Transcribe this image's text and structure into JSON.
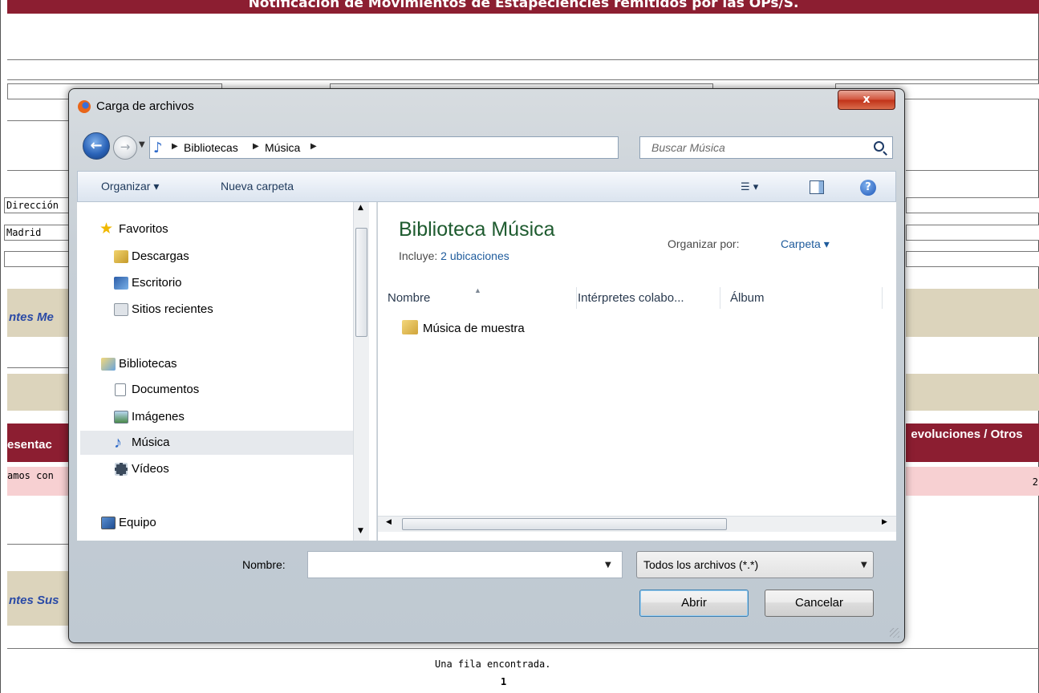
{
  "background": {
    "banner_title": "Notificación de Movimientos de Estapeciencies remitidos por las OPs/S.",
    "field_direccion": "Dirección",
    "field_madrid": "Madrid",
    "section_1": "ntes Me",
    "section_2": "ntes Sus",
    "table_header_left": "esentac",
    "table_header_right": "evoluciones / Otros",
    "row_text_left": "amos con",
    "row_value_right": "2",
    "footer_rows_found": "Una fila encontrada.",
    "footer_page": "1"
  },
  "dialog": {
    "title": "Carga de archivos",
    "close_label": "x",
    "breadcrumbs": [
      "Bibliotecas",
      "Música"
    ],
    "search_placeholder": "Buscar Música",
    "toolbar": {
      "organize": "Organizar ▾",
      "new_folder": "Nueva carpeta",
      "help": "?"
    },
    "nav": {
      "favorites": "Favoritos",
      "downloads": "Descargas",
      "desktop": "Escritorio",
      "recent": "Sitios recientes",
      "libraries": "Bibliotecas",
      "documents": "Documentos",
      "pictures": "Imágenes",
      "music": "Música",
      "videos": "Vídeos",
      "computer": "Equipo"
    },
    "content": {
      "library_title": "Biblioteca Música",
      "includes_label": "Incluye:",
      "includes_link": "2 ubicaciones",
      "arrange_label": "Organizar por:",
      "arrange_value": "Carpeta ▾",
      "columns": [
        "Nombre",
        "Intérpretes colabo...",
        "Álbum"
      ],
      "files": [
        {
          "name": "Música de muestra"
        }
      ]
    },
    "footer": {
      "name_label": "Nombre:",
      "name_value": "",
      "filter": "Todos los archivos (*.*)",
      "open_button": "Abrir",
      "cancel_button": "Cancelar"
    }
  }
}
